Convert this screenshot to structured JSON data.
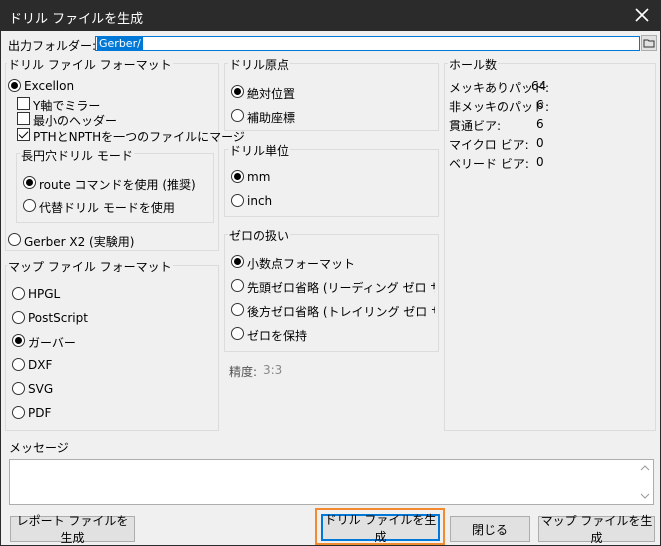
{
  "window": {
    "title": "ドリル ファイルを生成"
  },
  "output": {
    "label": "出力フォルダー:",
    "value": "Gerber/"
  },
  "drill_format": {
    "title": "ドリル ファイル フォーマット",
    "excellon": "Excellon",
    "mirror_y": "Y軸でミラー",
    "minimal_header": "最小のヘッダー",
    "merge_pth_npth": "PTHとNPTHを一つのファイルにマージ",
    "oval_mode": {
      "title": "長円穴ドリル モード",
      "route": "route コマンドを使用 (推奨)",
      "alternate": "代替ドリル モードを使用"
    },
    "gerber_x2": "Gerber X2 (実験用)"
  },
  "map_format": {
    "title": "マップ ファイル フォーマット",
    "options": [
      "HPGL",
      "PostScript",
      "ガーバー",
      "DXF",
      "SVG",
      "PDF"
    ],
    "selected_index": 2
  },
  "drill_origin": {
    "title": "ドリル原点",
    "absolute": "絶対位置",
    "aux": "補助座標"
  },
  "drill_units": {
    "title": "ドリル単位",
    "mm": "mm",
    "inch": "inch"
  },
  "zeros": {
    "title": "ゼロの扱い",
    "decimal": "小数点フォーマット",
    "suppress_leading": "先頭ゼロ省略 (リーディング ゼロ サプレス",
    "suppress_trailing": "後方ゼロ省略 (トレイリング ゼロ サプレス",
    "keep": "ゼロを保持"
  },
  "precision": {
    "label": "精度:",
    "value": "3:3"
  },
  "hole_counts": {
    "title": "ホール数",
    "rows": [
      {
        "label": "メッキありパッド:",
        "value": "64"
      },
      {
        "label": "非メッキのパッド:",
        "value": "6"
      },
      {
        "label": "貫通ビア:",
        "value": "6"
      },
      {
        "label": "マイクロ ビア:",
        "value": "0"
      },
      {
        "label": "ベリード ビア:",
        "value": "0"
      }
    ]
  },
  "messages": {
    "title": "メッセージ"
  },
  "buttons": {
    "report": "レポート ファイルを生成",
    "generate_drill": "ドリル ファイルを生成",
    "close": "閉じる",
    "generate_map": "マップ ファイルを生成"
  },
  "colors": {
    "titlebar": "#2b2b2b",
    "accent": "#0078d7",
    "highlight": "#f28a30"
  }
}
